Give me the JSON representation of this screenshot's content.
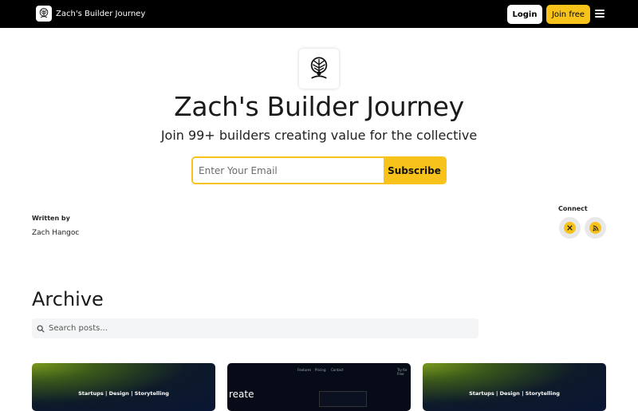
{
  "header": {
    "brand_name": "Zach's Builder Journey",
    "login_label": "Login",
    "join_label": "Join free",
    "icons": [
      "tree-logo-icon",
      "menu-icon"
    ]
  },
  "hero": {
    "title": "Zach's Builder Journey",
    "subtitle": "Join 99+ builders creating value for the collective",
    "email_placeholder": "Enter Your Email",
    "subscribe_label": "Subscribe"
  },
  "author": {
    "written_by_label": "Written by",
    "name": "Zach Hangoc"
  },
  "connect": {
    "label": "Connect",
    "icons": [
      "x-icon",
      "rss-icon"
    ]
  },
  "archive": {
    "title": "Archive",
    "search_placeholder": "Search posts..."
  },
  "posts": [
    {
      "tag": "Startups | Design | Storytelling"
    },
    {
      "word": "reate",
      "nav": [
        "Features",
        "Pricing",
        "Contact",
        "Try for Free"
      ]
    },
    {
      "tag": "Startups | Design | Storytelling"
    }
  ],
  "colors": {
    "accent": "#f7c31a",
    "nav_bg": "#000000",
    "search_bg": "#f4f5f6"
  }
}
